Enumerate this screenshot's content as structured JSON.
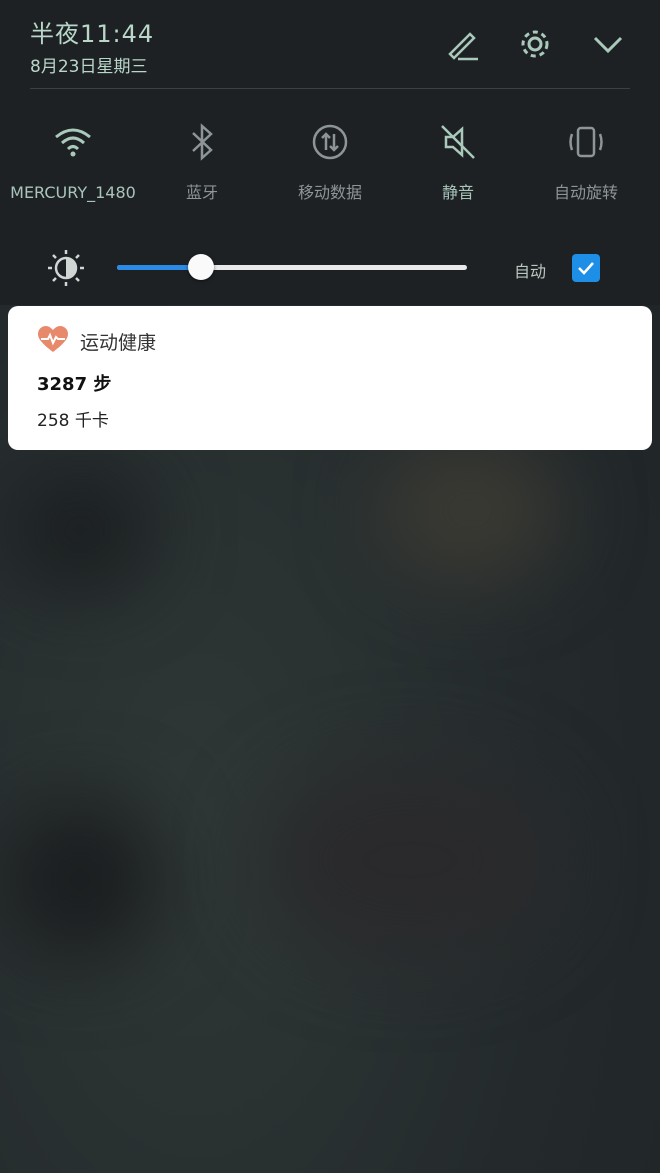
{
  "status": {
    "time": "半夜11:44",
    "date": "8月23日星期三"
  },
  "header_icons": [
    "edit-icon",
    "settings-icon",
    "collapse-chevron-icon"
  ],
  "toggles": [
    {
      "label": "MERCURY_1480",
      "icon": "wifi-icon",
      "active": true
    },
    {
      "label": "蓝牙",
      "icon": "bluetooth-icon",
      "active": false
    },
    {
      "label": "移动数据",
      "icon": "mobile-data-icon",
      "active": false
    },
    {
      "label": "静音",
      "icon": "mute-icon",
      "active": true
    },
    {
      "label": "自动旋转",
      "icon": "auto-rotate-icon",
      "active": false
    }
  ],
  "brightness": {
    "level": 0.24,
    "auto_label": "自动",
    "auto_checked": true
  },
  "notification": {
    "app_name": "运动健康",
    "steps": "3287 步",
    "calories": "258 千卡",
    "accent": "#e8896b"
  },
  "colors": {
    "panel_bg": "#1d2124",
    "accent_text": "#b9d7c9",
    "slider_blue": "#2a8ae6"
  }
}
